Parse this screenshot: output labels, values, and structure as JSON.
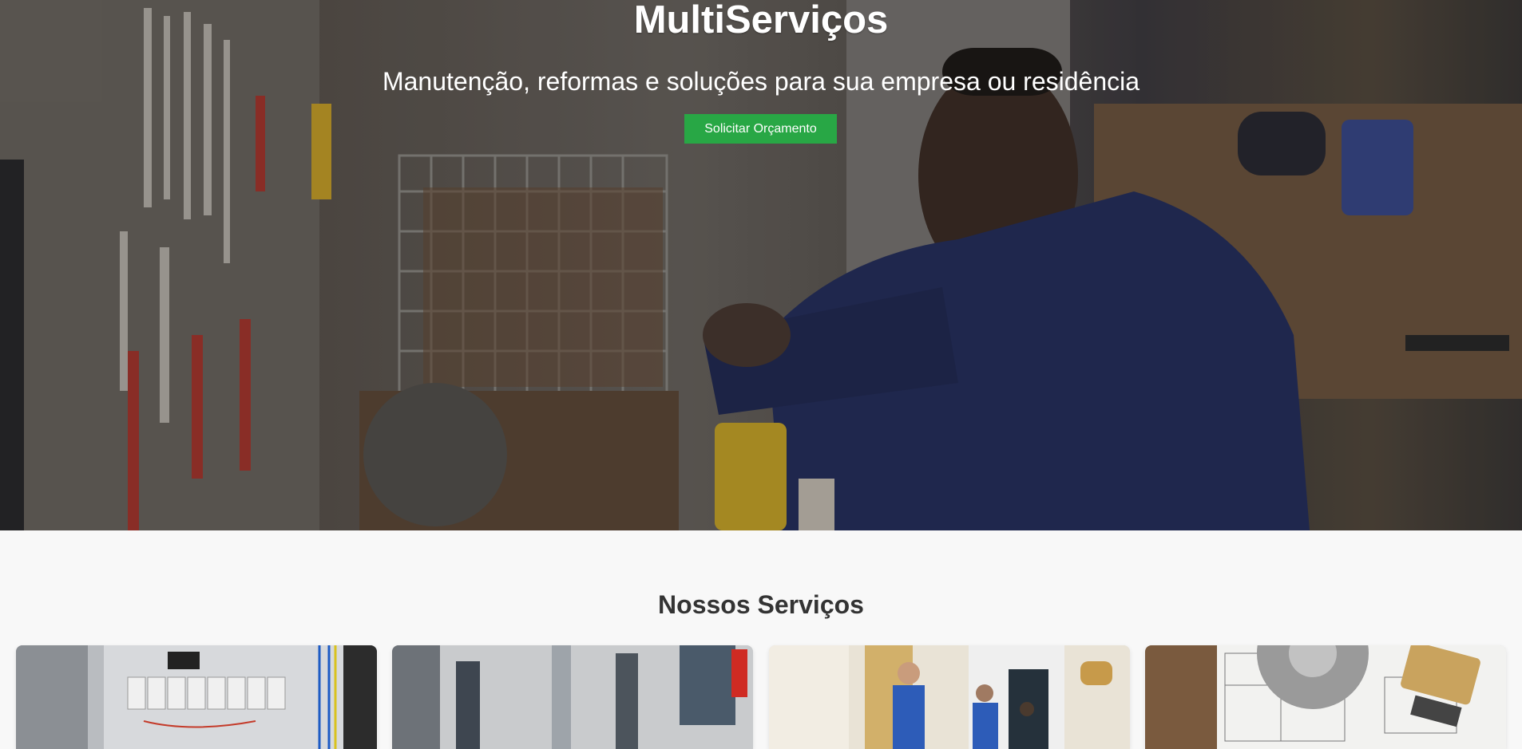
{
  "hero": {
    "title": "MultiServiços",
    "subtitle": "Manutenção, reformas e soluções para sua empresa ou residência",
    "cta_label": "Solicitar Orçamento",
    "cta_color": "#28a745"
  },
  "services": {
    "title": "Nossos Serviços",
    "cards": [
      {
        "image": "electrical-panel-photo"
      },
      {
        "image": "plumbing-pipes-photo"
      },
      {
        "image": "cleaning-team-photo"
      },
      {
        "image": "blueprint-saw-brush-photo"
      }
    ]
  },
  "colors": {
    "accent": "#28a745",
    "section_bg": "#f8f8f8",
    "heading": "#333333"
  }
}
